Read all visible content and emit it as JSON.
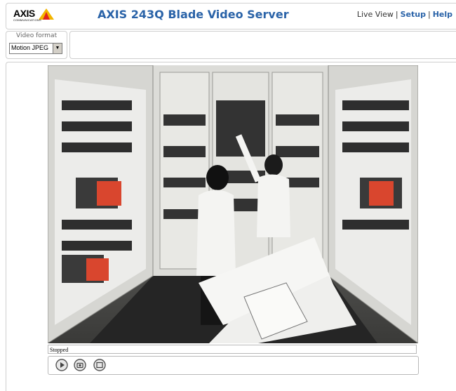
{
  "header": {
    "logo_text": "AXIS",
    "logo_sub": "COMMUNICATIONS",
    "title": "AXIS 243Q Blade Video Server",
    "nav": {
      "live_view": "Live View",
      "sep1": "|",
      "setup": "Setup",
      "sep2": "|",
      "help": "Help"
    },
    "accent_color": "#2a63a8"
  },
  "video_format": {
    "label": "Video format",
    "selected": "Motion JPEG"
  },
  "player": {
    "status_text": "Stopped",
    "controls": [
      "play-icon",
      "snapshot-icon",
      "fullscreen-icon"
    ]
  }
}
